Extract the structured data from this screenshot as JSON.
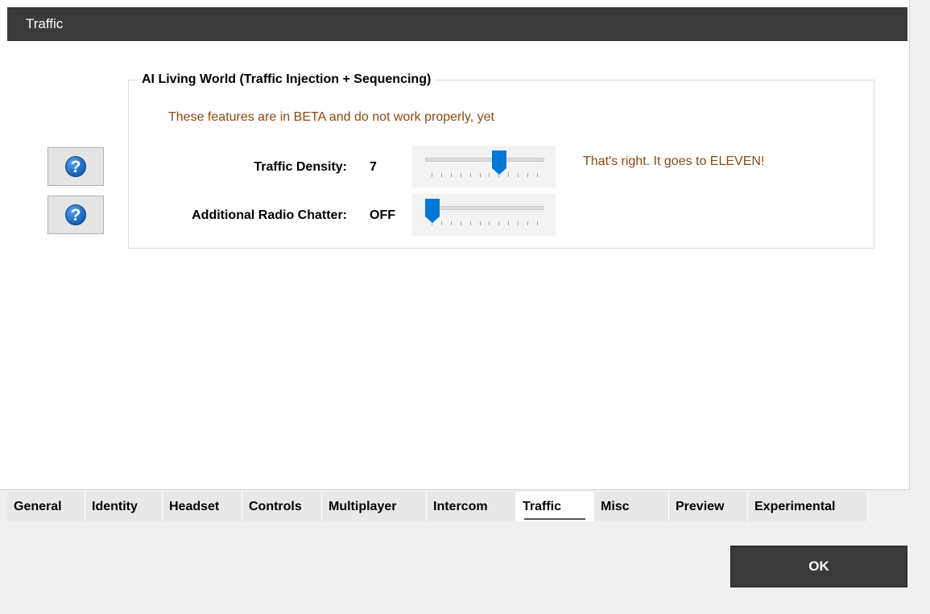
{
  "window": {
    "title": "Traffic"
  },
  "group": {
    "title": "AI Living World (Traffic Injection + Sequencing)",
    "beta_note": "These features are in BETA and do not work properly, yet"
  },
  "settings": [
    {
      "label": "Traffic Density:",
      "value": "7",
      "slider_level": 7,
      "slider_max": 11,
      "note": "That's right. It goes to ELEVEN!"
    },
    {
      "label": "Additional Radio Chatter:",
      "value": "OFF",
      "slider_level": 0,
      "slider_max": 11
    }
  ],
  "help": {
    "icon": "question-mark-icon",
    "glyph": "?"
  },
  "tabs": [
    {
      "label": "General"
    },
    {
      "label": "Identity"
    },
    {
      "label": "Headset"
    },
    {
      "label": "Controls"
    },
    {
      "label": "Multiplayer"
    },
    {
      "label": "Intercom"
    },
    {
      "label": "Traffic",
      "active": true
    },
    {
      "label": "Misc"
    },
    {
      "label": "Preview"
    },
    {
      "label": "Experimental"
    }
  ],
  "buttons": {
    "ok": "OK"
  },
  "colors": {
    "accent": "#0078d7",
    "titlebar": "#3a3a3a",
    "note_text": "#8a4a12"
  }
}
